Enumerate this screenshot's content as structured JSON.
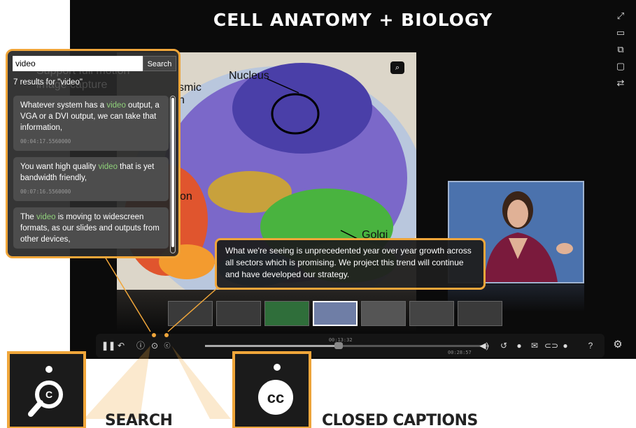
{
  "player": {
    "title": "CELL ANATOMY + BIOLOGY",
    "slide_labels": {
      "nucleus": "Nucleus",
      "cytoplasmic": "smic",
      "cytoplasmic2": "n",
      "on": "on",
      "golgi": "Golgi"
    },
    "current_time": "00:13:32",
    "total_time": "00:28:57",
    "progress_fraction": 0.47
  },
  "search": {
    "query": "video",
    "button_label": "Search",
    "results_count_text": "7 results for \"video\"",
    "results": [
      {
        "before": "Whatever system has a ",
        "highlight": "video",
        "after": " output, a VGA or a DVI output, we can take that information,",
        "timestamp": "00:04:17.5560000"
      },
      {
        "before": "You want high quality ",
        "highlight": "video",
        "after": " that is yet bandwidth friendly,",
        "timestamp": "00:07:16.5560000"
      },
      {
        "before": "The ",
        "highlight": "video",
        "after": " is moving to widescreen formats, as our slides and outputs from other devices,",
        "timestamp": ""
      }
    ]
  },
  "caption": {
    "text": "What we're seeing is unprecedented year over year growth across all sectors which is promising. We project this trend will continue and have developed our strategy."
  },
  "background_text": "Support full motion image capture",
  "callouts": {
    "search_label": "SEARCH",
    "cc_label": "CLOSED CAPTIONS",
    "cc_glyph": "cc"
  },
  "colors": {
    "accent": "#f0a63a",
    "highlight": "#8fd17a"
  }
}
